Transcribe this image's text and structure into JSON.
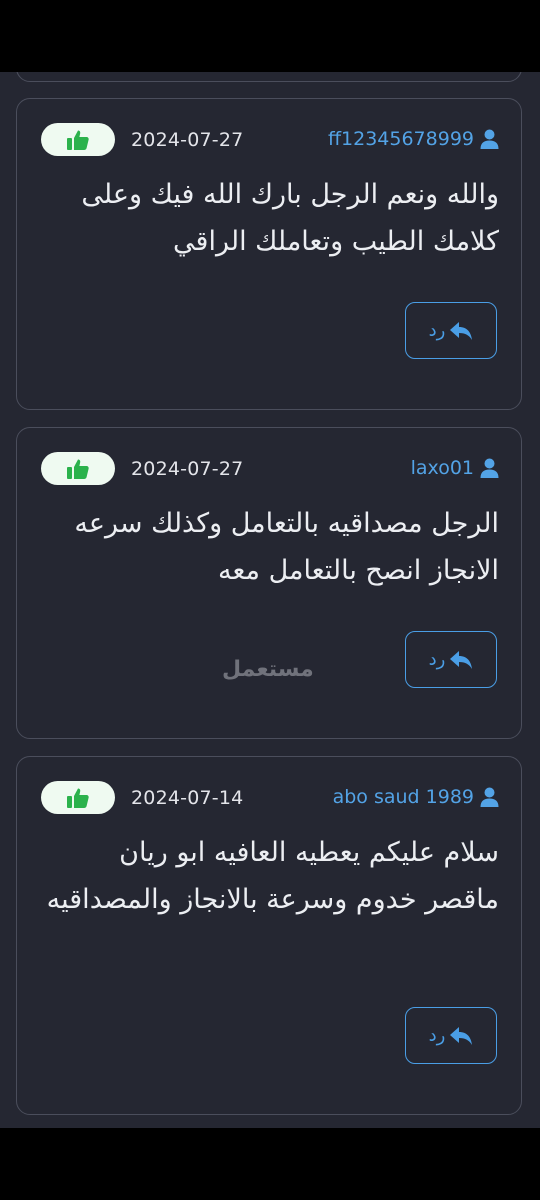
{
  "comments": [
    {
      "username": "ff12345678999",
      "date": "2024-07-27",
      "text": "والله ونعم الرجل بارك الله فيك وعلى كلامك الطيب وتعاملك الراقي",
      "reply_label": "رد"
    },
    {
      "username": "laxo01",
      "date": "2024-07-27",
      "text": "الرجل مصداقيه بالتعامل وكذلك سرعه الانجاز انصح بالتعامل معه",
      "reply_label": "رد"
    },
    {
      "username": "abo saud 1989",
      "date": "2024-07-14",
      "text": "سلام عليكم يعطيه العافيه ابو ريان ماقصر خدوم وسرعة بالانجاز والمصداقيه",
      "reply_label": "رد"
    }
  ],
  "watermark": "مستعمل",
  "icons": {
    "like": "thumbs-up-icon",
    "user": "user-icon",
    "reply": "reply-arrow-icon"
  },
  "colors": {
    "background": "#252732",
    "card_border": "#4b4e5c",
    "accent": "#4a9ee6",
    "like_green": "#2bb24c",
    "like_bg": "#effaf1"
  }
}
